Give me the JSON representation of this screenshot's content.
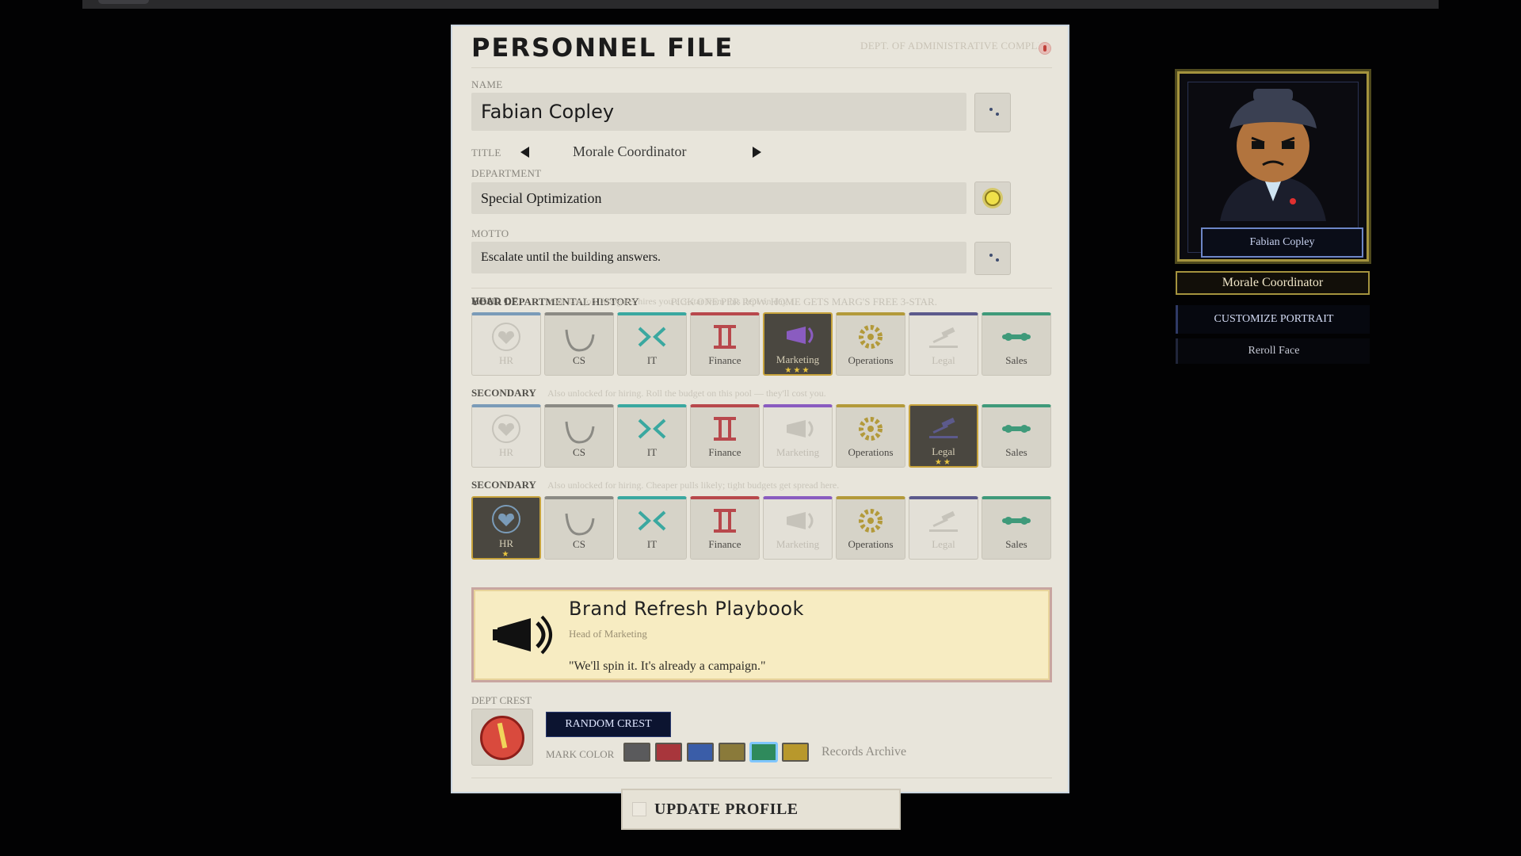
{
  "header": {
    "title": "PERSONNEL FILE",
    "dept": "DEPT. OF ADMINISTRATIVE COMPLIANCE"
  },
  "name": {
    "label": "NAME",
    "value": "Fabian Copley"
  },
  "title": {
    "label": "TITLE",
    "value": "Morale Coordinator"
  },
  "department": {
    "label": "DEPARTMENT",
    "value": "Special Optimization"
  },
  "motto": {
    "label": "MOTTO",
    "value": "Escalate until the building answers."
  },
  "history": {
    "heading": "YOUR DEPARTMENTAL HISTORY",
    "note": "PICK ONE PER ROW. HOME GETS MARG'S FREE 3-STAR.",
    "rows": [
      {
        "label": "HEAD OF",
        "note": "Your last job. Margaret hires you a 3-star from this dept on day 1.",
        "selected": "Marketing",
        "stars": "★★★"
      },
      {
        "label": "SECONDARY",
        "note": "Also unlocked for hiring. Roll the budget on this pool — they'll cost you.",
        "selected": "Legal",
        "stars": "★★"
      },
      {
        "label": "SECONDARY",
        "note": "Also unlocked for hiring. Cheaper pulls likely; tight budgets get spread here.",
        "selected": "HR",
        "stars": "★"
      }
    ],
    "depts": [
      "HR",
      "CS",
      "IT",
      "Finance",
      "Marketing",
      "Operations",
      "Legal",
      "Sales"
    ],
    "dept_colors": {
      "HR": "#7a9bb8",
      "CS": "#8b8a84",
      "IT": "#3aa8a0",
      "Finance": "#b8484c",
      "Marketing": "#8a5cc0",
      "Operations": "#b39a3a",
      "Legal": "#5c5a8c",
      "Sales": "#3f9a7a"
    }
  },
  "card": {
    "title": "Brand Refresh Playbook",
    "subtitle": "Head of Marketing",
    "quote": "\"We'll spin it. It's already a campaign.\""
  },
  "crest": {
    "label": "DEPT CREST",
    "random_label": "RANDOM CREST",
    "mark_label": "MARK COLOR",
    "archive_label": "Records Archive",
    "swatches": [
      "#5a5a5c",
      "#a8363c",
      "#3a5da8",
      "#8a7a3a",
      "#2f8a5c",
      "#b8982c"
    ],
    "selected_swatch": 4
  },
  "update_label": "UPDATE PROFILE",
  "portrait": {
    "name": "Fabian Copley",
    "role": "Morale Coordinator",
    "customize_label": "CUSTOMIZE PORTRAIT",
    "reroll_label": "Reroll Face"
  }
}
